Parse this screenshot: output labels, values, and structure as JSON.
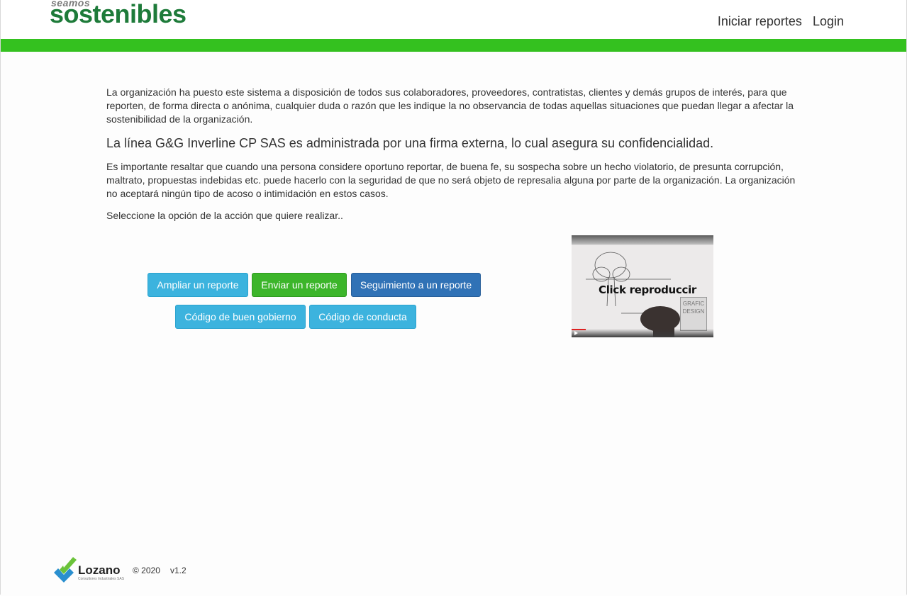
{
  "header": {
    "logo_small": "seamos",
    "logo_big": "sostenibles",
    "nav": [
      "Iniciar reportes",
      "Login"
    ]
  },
  "colors": {
    "brand_green": "#1e7b3a",
    "bar_green": "#34c11f",
    "info": "#3cb3de",
    "success": "#3cb52a",
    "primary": "#3072b6"
  },
  "content": {
    "intro": "La organización ha puesto este sistema a disposición de todos sus colaboradores, proveedores, contratistas, clientes y demás grupos de interés, para que reporten, de forma directa o anónima, cualquier duda o razón que les indique la no observancia de todas aquellas situaciones que puedan llegar a afectar la sostenibilidad de la organización.",
    "lead": "La línea G&G Inverline CP SAS es administrada por una firma externa, lo cual asegura su confidencialidad.",
    "important": "Es importante resaltar que cuando una persona considere oportuno reportar, de buena fe, su sospecha sobre un hecho violatorio, de presunta corrupción, maltrato, propuestas indebidas etc. puede hacerlo con la seguridad de que no será objeto de represalia alguna por parte de la organización. La organización no aceptará ningún tipo de acoso o intimidación en estos casos.",
    "select": "Seleccione la opción de la acción que quiere realizar.."
  },
  "buttons": {
    "ampliar": "Ampliar un reporte",
    "enviar": "Enviar un reporte",
    "seguimiento": "Seguimiento a un reporte",
    "gobierno": "Código de buen gobierno",
    "conducta": "Código de conducta"
  },
  "video": {
    "overlay_text": "Click reproduccir",
    "stamp_text": "GRAFIC DESIGN"
  },
  "footer": {
    "brand": "Lozano",
    "brand_sub": "Consultores Industriales SAS",
    "copyright": "© 2020",
    "version": "v1.2"
  }
}
